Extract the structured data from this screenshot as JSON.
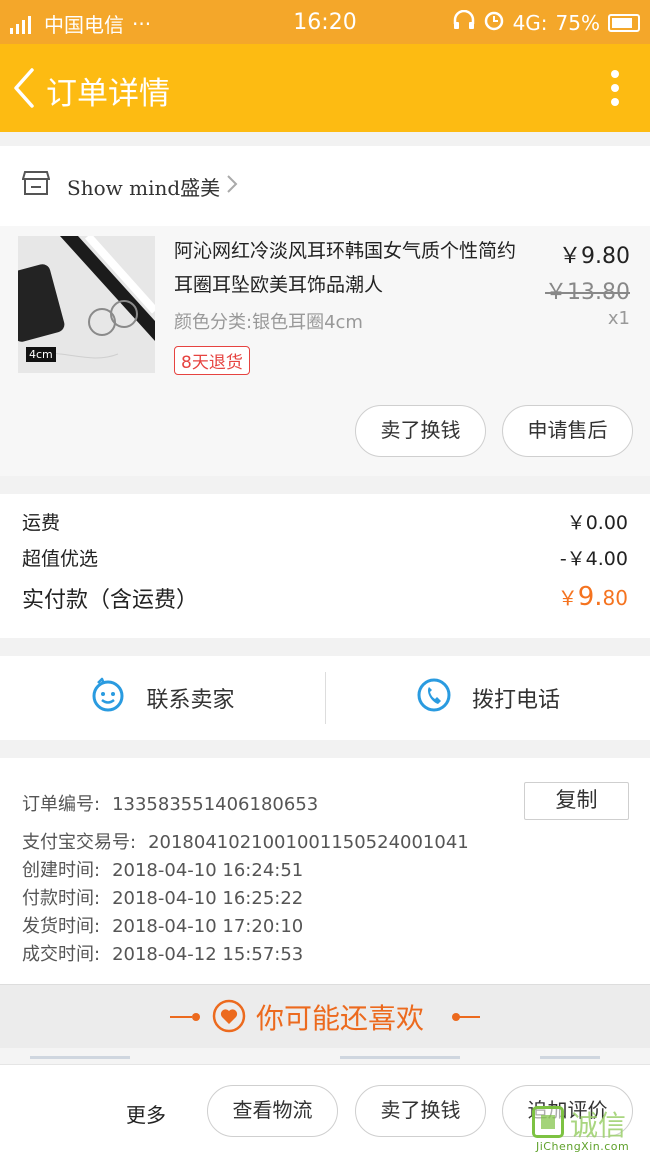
{
  "status_bar": {
    "network_small": "4G",
    "carrier": "中国电信",
    "more_dots": "···",
    "time": "16:20",
    "network": "4G:",
    "battery": "75%"
  },
  "nav": {
    "title": "订单详情"
  },
  "shop": {
    "name": "Show mind盛美"
  },
  "item": {
    "title": "阿沁网红冷淡风耳环韩国女气质个性简约耳圈耳坠欧美耳饰品潮人",
    "sku": "颜色分类:银色耳圈4cm",
    "image_tag": "4cm",
    "refund_badge": "8天退货",
    "price": "￥9.80",
    "original_price": "￥13.80",
    "quantity": "x1",
    "actions": [
      "卖了换钱",
      "申请售后"
    ]
  },
  "fees": {
    "shipping_label": "运费",
    "shipping_value": "￥0.00",
    "discount_label": "超值优选",
    "discount_value": "-￥4.00",
    "total_label": "实付款（含运费）",
    "total_currency": "￥",
    "total_int": "9.",
    "total_dec": "80"
  },
  "contact": {
    "seller": "联系卖家",
    "phone": "拨打电话"
  },
  "order_info": {
    "order_no_label": "订单编号:",
    "order_no": "133583551406180653",
    "copy": "复制",
    "alipay_label": "支付宝交易号:",
    "alipay_no": "2018041021001001150524001041",
    "created_label": "创建时间:",
    "created": "2018-04-10 16:24:51",
    "paid_label": "付款时间:",
    "paid": "2018-04-10 16:25:22",
    "shipped_label": "发货时间:",
    "shipped": "2018-04-10 17:20:10",
    "closed_label": "成交时间:",
    "closed": "2018-04-12 15:57:53"
  },
  "recommend": {
    "title": "你可能还喜欢"
  },
  "bottom_bar": {
    "more": "更多",
    "buttons": [
      "查看物流",
      "卖了换钱",
      "追加评价"
    ]
  },
  "watermark": {
    "cn": "诚信",
    "en": "JiChengXin.com"
  },
  "colors": {
    "header": "#fdbb12",
    "status_bar": "#f4a72a",
    "accent_orange": "#ec6a1e",
    "refund_red": "#e64340",
    "icon_blue": "#2a9be0"
  }
}
